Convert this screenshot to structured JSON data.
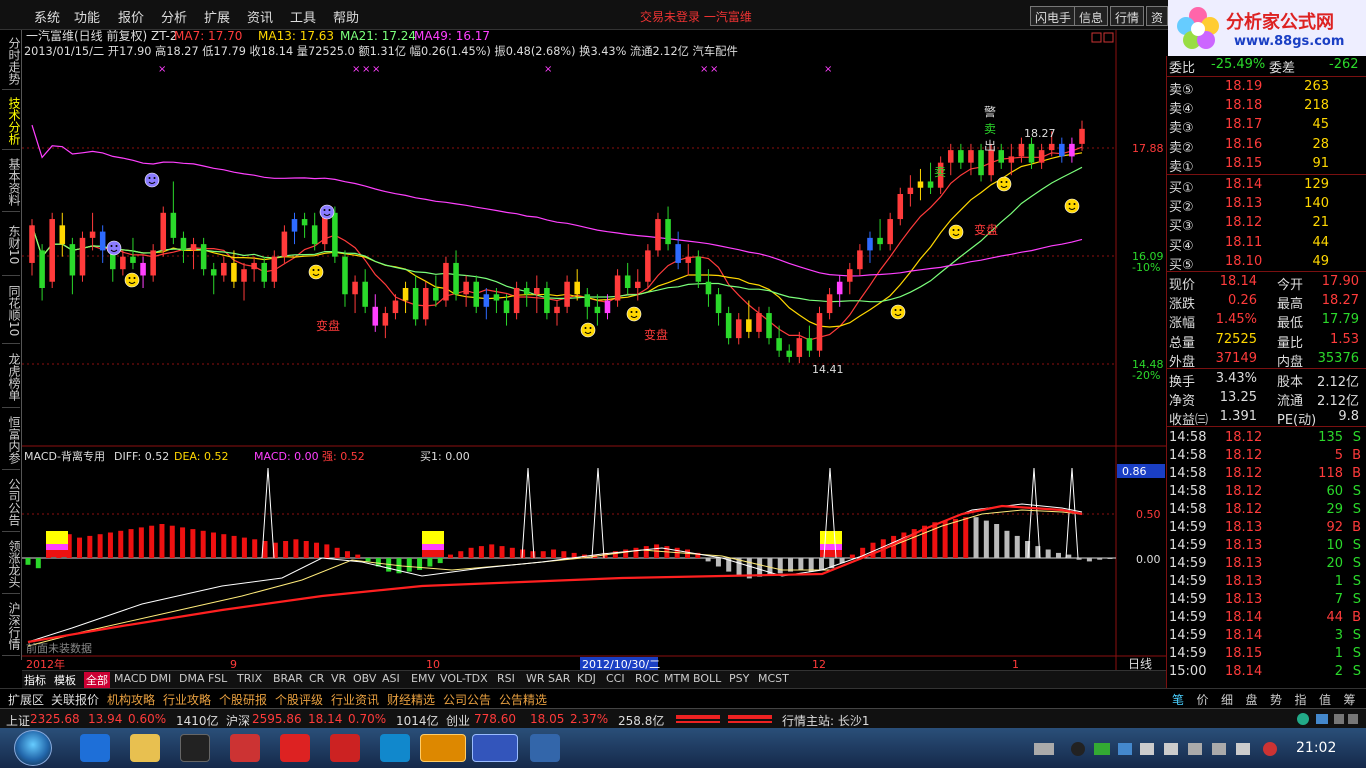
{
  "menu": {
    "items": [
      "系统",
      "功能",
      "报价",
      "分析",
      "扩展",
      "资讯",
      "工具",
      "帮助"
    ],
    "title": "交易未登录  一汽富维",
    "buttons": [
      "闪电手",
      "信息",
      "行情",
      "资"
    ]
  },
  "logo": {
    "line1": "分析家公式网",
    "line2": "www.88gs.com"
  },
  "left_tabs": [
    "分时走势",
    "技术分析",
    "基本资料",
    "东财10",
    "同花顺10",
    "龙虎榜单",
    "恒富内参",
    "公司公告",
    "领涨龙头",
    "沪深行情"
  ],
  "chart": {
    "stock_line": "一汽富维(日线 前复权) ZT-2",
    "ma_labels": [
      {
        "text": "MA7: 17.70",
        "color": "#ff3b3b"
      },
      {
        "text": "MA13: 17.63",
        "color": "#ffd700"
      },
      {
        "text": "MA21: 17.24",
        "color": "#7bff7b"
      },
      {
        "text": "MA49: 16.17",
        "color": "#ff40ff"
      }
    ],
    "info_line": "2013/01/15/二 开17.90 高18.27 低17.79 收18.14 量72525.0 额1.31亿 幅0.26(1.45%) 振0.48(2.68%) 换3.43% 流通2.12亿 汽车配件",
    "price_axis": [
      {
        "label": "17.88",
        "sub": ""
      },
      {
        "label": "16.09",
        "sub": "-10%"
      },
      {
        "label": "14.48",
        "sub": "-20%"
      }
    ],
    "annotations": {
      "high": "18.27",
      "low": "14.41",
      "biandpan": "变盘",
      "mai": "卖",
      "jing": "警",
      "chu": "出"
    },
    "macd_title": "MACD-背离专用",
    "macd_diff": "DIFF: 0.52",
    "macd_dea": "DEA: 0.52",
    "macd_macd": "MACD: 0.00",
    "macd_qiang": "强: 0.52",
    "macd_buy": "买1: 0.00",
    "macd_axis": [
      "0.86",
      "0.50",
      "0.00"
    ],
    "no_data": "前面未装数据",
    "x_labels": [
      "2012年",
      "9",
      "10",
      "2012/10/30/二",
      "12",
      "1"
    ],
    "period": "日线"
  },
  "indicator_tabs": [
    "指标",
    "模板",
    "全部",
    "MACD",
    "DMI",
    "DMA",
    "FSL",
    "TRIX",
    "BRAR",
    "CR",
    "VR",
    "OBV",
    "ASI",
    "EMV",
    "VOL-TDX",
    "RSI",
    "WR",
    "SAR",
    "KDJ",
    "CCI",
    "ROC",
    "MTM",
    "BOLL",
    "PSY",
    "MCST"
  ],
  "ext_tabs": [
    "扩展区",
    "关联报价",
    "机构攻略",
    "行业攻略",
    "个股研报",
    "个股评级",
    "行业资讯",
    "财经精选",
    "公司公告",
    "公告精选"
  ],
  "right_tabs": [
    "笔",
    "价",
    "细",
    "盘",
    "势",
    "指",
    "值",
    "筹"
  ],
  "quote": {
    "weibi_label": "委比",
    "weibi": "-25.49%",
    "weicha_label": "委差",
    "weicha": "-262",
    "sell": [
      {
        "label": "卖⑤",
        "price": "18.19",
        "vol": "263"
      },
      {
        "label": "卖④",
        "price": "18.18",
        "vol": "218"
      },
      {
        "label": "卖③",
        "price": "18.17",
        "vol": "45"
      },
      {
        "label": "卖②",
        "price": "18.16",
        "vol": "28"
      },
      {
        "label": "卖①",
        "price": "18.15",
        "vol": "91"
      }
    ],
    "buy": [
      {
        "label": "买①",
        "price": "18.14",
        "vol": "129"
      },
      {
        "label": "买②",
        "price": "18.13",
        "vol": "140"
      },
      {
        "label": "买③",
        "price": "18.12",
        "vol": "21"
      },
      {
        "label": "买④",
        "price": "18.11",
        "vol": "44"
      },
      {
        "label": "买⑤",
        "price": "18.10",
        "vol": "49"
      }
    ],
    "stats": [
      {
        "l1": "现价",
        "v1": "18.14",
        "c1": "#ff3b3b",
        "l2": "今开",
        "v2": "17.90",
        "c2": "#ff3b3b"
      },
      {
        "l1": "涨跌",
        "v1": "0.26",
        "c1": "#ff3b3b",
        "l2": "最高",
        "v2": "18.27",
        "c2": "#ff3b3b"
      },
      {
        "l1": "涨幅",
        "v1": "1.45%",
        "c1": "#ff3b3b",
        "l2": "最低",
        "v2": "17.79",
        "c2": "#2bd92b"
      },
      {
        "l1": "总量",
        "v1": "72525",
        "c1": "#ffd700",
        "l2": "量比",
        "v2": "1.53",
        "c2": "#ff3b3b"
      },
      {
        "l1": "外盘",
        "v1": "37149",
        "c1": "#ff3b3b",
        "l2": "内盘",
        "v2": "35376",
        "c2": "#2bd92b"
      }
    ],
    "stats2": [
      {
        "l1": "换手",
        "v1": "3.43%",
        "l2": "股本",
        "v2": "2.12亿"
      },
      {
        "l1": "净资",
        "v1": "13.25",
        "l2": "流通",
        "v2": "2.12亿"
      },
      {
        "l1": "收益㈢",
        "v1": "1.391",
        "l2": "PE(动)",
        "v2": "9.8"
      }
    ],
    "ticks": [
      {
        "t": "14:58",
        "p": "18.12",
        "v": "135",
        "s": "S"
      },
      {
        "t": "14:58",
        "p": "18.12",
        "v": "5",
        "s": "B"
      },
      {
        "t": "14:58",
        "p": "18.12",
        "v": "118",
        "s": "B"
      },
      {
        "t": "14:58",
        "p": "18.12",
        "v": "60",
        "s": "S"
      },
      {
        "t": "14:58",
        "p": "18.12",
        "v": "29",
        "s": "S"
      },
      {
        "t": "14:59",
        "p": "18.13",
        "v": "92",
        "s": "B"
      },
      {
        "t": "14:59",
        "p": "18.13",
        "v": "10",
        "s": "S"
      },
      {
        "t": "14:59",
        "p": "18.13",
        "v": "20",
        "s": "S"
      },
      {
        "t": "14:59",
        "p": "18.13",
        "v": "1",
        "s": "S"
      },
      {
        "t": "14:59",
        "p": "18.13",
        "v": "7",
        "s": "S"
      },
      {
        "t": "14:59",
        "p": "18.14",
        "v": "44",
        "s": "B"
      },
      {
        "t": "14:59",
        "p": "18.14",
        "v": "3",
        "s": "S"
      },
      {
        "t": "14:59",
        "p": "18.15",
        "v": "1",
        "s": "S"
      },
      {
        "t": "15:00",
        "p": "18.14",
        "v": "2",
        "s": "S"
      }
    ]
  },
  "status": {
    "sh_label": "上证",
    "sh_val": "2325.68",
    "sh_chg": "13.94",
    "sh_pct": "0.60%",
    "sh_amt": "1410亿",
    "hs_label": "沪深",
    "hs_val": "2595.86",
    "hs_chg": "18.14",
    "hs_pct": "0.70%",
    "hs_amt": "1014亿",
    "cy_label": "创业",
    "cy_val": "778.60",
    "cy_chg": "18.05",
    "cy_pct": "2.37%",
    "cy_amt": "258.8亿",
    "station": "行情主站: 长沙1"
  },
  "taskbar": {
    "clock": "21:02"
  },
  "candles": [
    [
      16.0,
      16.7,
      15.8,
      16.6
    ],
    [
      16.2,
      16.3,
      15.4,
      15.6
    ],
    [
      15.7,
      16.8,
      15.6,
      16.7
    ],
    [
      16.6,
      16.8,
      16.1,
      16.3
    ],
    [
      16.3,
      16.4,
      15.5,
      15.8
    ],
    [
      15.8,
      16.5,
      15.7,
      16.4
    ],
    [
      16.4,
      16.8,
      16.2,
      16.5
    ],
    [
      16.5,
      16.6,
      16.0,
      16.2
    ],
    [
      16.2,
      16.3,
      15.7,
      15.9
    ],
    [
      15.9,
      16.2,
      15.8,
      16.1
    ],
    [
      16.1,
      16.4,
      15.9,
      16.0
    ],
    [
      16.0,
      16.1,
      15.6,
      15.8
    ],
    [
      15.8,
      16.3,
      15.7,
      16.2
    ],
    [
      16.2,
      16.9,
      16.1,
      16.8
    ],
    [
      16.8,
      17.3,
      16.3,
      16.4
    ],
    [
      16.4,
      16.5,
      16.0,
      16.2
    ],
    [
      16.2,
      16.4,
      15.9,
      16.3
    ],
    [
      16.3,
      16.4,
      15.8,
      15.9
    ],
    [
      15.9,
      16.0,
      15.5,
      15.8
    ],
    [
      15.8,
      16.1,
      15.7,
      16.0
    ],
    [
      16.0,
      16.2,
      15.6,
      15.7
    ],
    [
      15.7,
      16.0,
      15.4,
      15.9
    ],
    [
      15.9,
      16.1,
      15.7,
      16.0
    ],
    [
      16.0,
      16.1,
      15.6,
      15.7
    ],
    [
      15.7,
      16.2,
      15.6,
      16.1
    ],
    [
      16.1,
      16.6,
      16.0,
      16.5
    ],
    [
      16.5,
      16.8,
      16.3,
      16.7
    ],
    [
      16.7,
      16.8,
      16.4,
      16.6
    ],
    [
      16.6,
      16.8,
      16.2,
      16.3
    ],
    [
      16.3,
      16.9,
      16.2,
      16.8
    ],
    [
      16.8,
      16.9,
      16.0,
      16.1
    ],
    [
      16.1,
      16.2,
      15.3,
      15.5
    ],
    [
      15.5,
      15.8,
      15.2,
      15.7
    ],
    [
      15.7,
      15.9,
      15.2,
      15.3
    ],
    [
      15.3,
      15.5,
      14.9,
      15.0
    ],
    [
      15.0,
      15.3,
      14.8,
      15.2
    ],
    [
      15.2,
      15.5,
      15.1,
      15.4
    ],
    [
      15.4,
      15.7,
      15.2,
      15.6
    ],
    [
      15.6,
      15.8,
      15.0,
      15.1
    ],
    [
      15.1,
      15.7,
      15.0,
      15.6
    ],
    [
      15.6,
      15.8,
      15.3,
      15.4
    ],
    [
      15.4,
      16.1,
      15.3,
      16.0
    ],
    [
      16.0,
      16.2,
      15.4,
      15.5
    ],
    [
      15.5,
      15.8,
      15.3,
      15.7
    ],
    [
      15.7,
      15.8,
      15.2,
      15.3
    ],
    [
      15.3,
      15.6,
      15.1,
      15.5
    ],
    [
      15.5,
      15.6,
      15.2,
      15.4
    ],
    [
      15.4,
      15.5,
      15.0,
      15.2
    ],
    [
      15.2,
      15.7,
      15.1,
      15.6
    ],
    [
      15.6,
      15.7,
      15.3,
      15.5
    ],
    [
      15.5,
      15.8,
      15.2,
      15.6
    ],
    [
      15.6,
      15.7,
      15.1,
      15.2
    ],
    [
      15.2,
      15.4,
      15.0,
      15.3
    ],
    [
      15.3,
      15.8,
      15.2,
      15.7
    ],
    [
      15.7,
      15.9,
      15.4,
      15.5
    ],
    [
      15.5,
      15.6,
      15.1,
      15.3
    ],
    [
      15.3,
      15.5,
      15.0,
      15.2
    ],
    [
      15.2,
      15.5,
      15.1,
      15.4
    ],
    [
      15.4,
      15.9,
      15.3,
      15.8
    ],
    [
      15.8,
      16.0,
      15.5,
      15.6
    ],
    [
      15.6,
      15.9,
      15.4,
      15.7
    ],
    [
      15.7,
      16.3,
      15.6,
      16.2
    ],
    [
      16.2,
      16.8,
      16.1,
      16.7
    ],
    [
      16.7,
      16.9,
      16.2,
      16.3
    ],
    [
      16.3,
      16.5,
      15.9,
      16.0
    ],
    [
      16.0,
      16.3,
      15.8,
      16.1
    ],
    [
      16.1,
      16.2,
      15.6,
      15.7
    ],
    [
      15.7,
      15.9,
      15.3,
      15.5
    ],
    [
      15.5,
      15.6,
      15.0,
      15.2
    ],
    [
      15.2,
      15.3,
      14.7,
      14.8
    ],
    [
      14.8,
      15.2,
      14.7,
      15.1
    ],
    [
      15.1,
      15.4,
      14.8,
      14.9
    ],
    [
      14.9,
      15.3,
      14.8,
      15.2
    ],
    [
      15.2,
      15.3,
      14.7,
      14.8
    ],
    [
      14.8,
      15.0,
      14.5,
      14.6
    ],
    [
      14.6,
      14.7,
      14.41,
      14.5
    ],
    [
      14.5,
      14.9,
      14.4,
      14.8
    ],
    [
      14.8,
      15.0,
      14.5,
      14.6
    ],
    [
      14.6,
      15.3,
      14.5,
      15.2
    ],
    [
      15.2,
      15.6,
      15.1,
      15.5
    ],
    [
      15.5,
      15.8,
      15.3,
      15.7
    ],
    [
      15.7,
      16.0,
      15.5,
      15.9
    ],
    [
      15.9,
      16.3,
      15.8,
      16.2
    ],
    [
      16.2,
      16.5,
      16.0,
      16.4
    ],
    [
      16.4,
      16.7,
      16.2,
      16.3
    ],
    [
      16.3,
      16.8,
      16.2,
      16.7
    ],
    [
      16.7,
      17.2,
      16.6,
      17.1
    ],
    [
      17.1,
      17.4,
      16.9,
      17.2
    ],
    [
      17.2,
      17.5,
      17.0,
      17.3
    ],
    [
      17.3,
      17.6,
      17.1,
      17.2
    ],
    [
      17.2,
      17.7,
      17.1,
      17.6
    ],
    [
      17.6,
      17.9,
      17.4,
      17.8
    ],
    [
      17.8,
      17.9,
      17.5,
      17.6
    ],
    [
      17.6,
      17.9,
      17.4,
      17.8
    ],
    [
      17.8,
      17.9,
      17.3,
      17.4
    ],
    [
      17.4,
      17.9,
      17.3,
      17.8
    ],
    [
      17.8,
      17.9,
      17.5,
      17.6
    ],
    [
      17.6,
      17.9,
      17.4,
      17.7
    ],
    [
      17.7,
      18.0,
      17.6,
      17.9
    ],
    [
      17.9,
      18.0,
      17.5,
      17.6
    ],
    [
      17.6,
      17.9,
      17.5,
      17.8
    ],
    [
      17.8,
      18.1,
      17.7,
      17.9
    ],
    [
      17.9,
      18.0,
      17.6,
      17.7
    ],
    [
      17.7,
      18.0,
      17.6,
      17.9
    ],
    [
      17.9,
      18.27,
      17.79,
      18.14
    ]
  ],
  "macd_bars": [
    -0.04,
    -0.06,
    0.12,
    0.13,
    0.14,
    0.12,
    0.13,
    0.14,
    0.15,
    0.16,
    0.17,
    0.18,
    0.19,
    0.2,
    0.19,
    0.18,
    0.17,
    0.16,
    0.15,
    0.14,
    0.13,
    0.12,
    0.11,
    0.1,
    0.09,
    0.1,
    0.11,
    0.1,
    0.09,
    0.08,
    0.06,
    0.04,
    0.02,
    -0.02,
    -0.05,
    -0.08,
    -0.09,
    -0.08,
    -0.07,
    -0.05,
    -0.03,
    0.02,
    0.04,
    0.06,
    0.07,
    0.08,
    0.07,
    0.06,
    0.05,
    0.04,
    0.04,
    0.05,
    0.04,
    0.03,
    0.02,
    0.02,
    0.03,
    0.04,
    0.05,
    0.06,
    0.07,
    0.08,
    0.07,
    0.06,
    0.05,
    0.03,
    -0.02,
    -0.05,
    -0.08,
    -0.1,
    -0.12,
    -0.11,
    -0.1,
    -0.09,
    -0.08,
    -0.07,
    -0.08,
    -0.07,
    -0.06,
    -0.03,
    0.02,
    0.06,
    0.09,
    0.11,
    0.13,
    0.15,
    0.17,
    0.19,
    0.21,
    0.22,
    0.23,
    0.24,
    0.24,
    0.22,
    0.2,
    0.16,
    0.13,
    0.1,
    0.07,
    0.05,
    0.03,
    0.02,
    -0.01,
    -0.02,
    -0.01,
    0.0
  ]
}
